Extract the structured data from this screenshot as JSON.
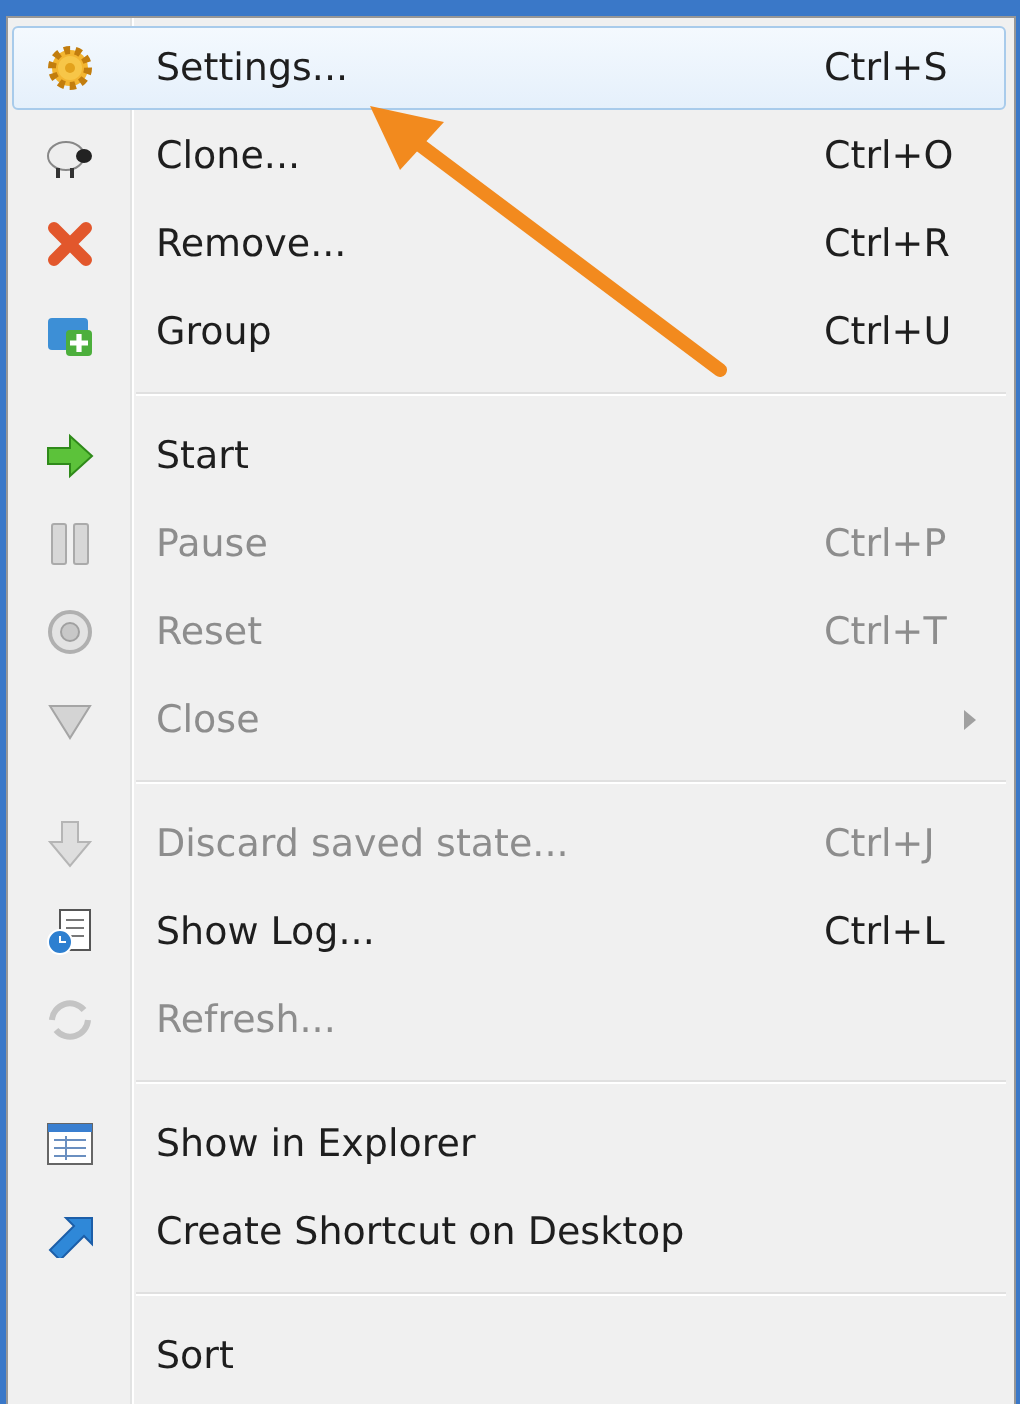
{
  "menu": {
    "sections": [
      [
        {
          "label": "Settings...",
          "shortcut": "Ctrl+S",
          "disabled": false,
          "selected": true
        },
        {
          "label": "Clone...",
          "shortcut": "Ctrl+O",
          "disabled": false,
          "selected": false
        },
        {
          "label": "Remove...",
          "shortcut": "Ctrl+R",
          "disabled": false,
          "selected": false
        },
        {
          "label": "Group",
          "shortcut": "Ctrl+U",
          "disabled": false,
          "selected": false
        }
      ],
      [
        {
          "label": "Start",
          "disabled": false,
          "selected": false
        },
        {
          "label": "Pause",
          "shortcut": "Ctrl+P",
          "disabled": true,
          "selected": false
        },
        {
          "label": "Reset",
          "shortcut": "Ctrl+T",
          "disabled": true,
          "selected": false
        },
        {
          "label": "Close",
          "disabled": true,
          "selected": false,
          "submenu": true
        }
      ],
      [
        {
          "label": "Discard saved state...",
          "shortcut": "Ctrl+J",
          "disabled": true,
          "selected": false
        },
        {
          "label": "Show Log...",
          "shortcut": "Ctrl+L",
          "disabled": false,
          "selected": false
        },
        {
          "label": "Refresh...",
          "disabled": true,
          "selected": false
        }
      ],
      [
        {
          "label": "Show in Explorer",
          "disabled": false,
          "selected": false
        },
        {
          "label": "Create Shortcut on Desktop",
          "disabled": false,
          "selected": false
        }
      ],
      [
        {
          "label": "Sort",
          "disabled": false,
          "selected": false
        }
      ]
    ]
  }
}
